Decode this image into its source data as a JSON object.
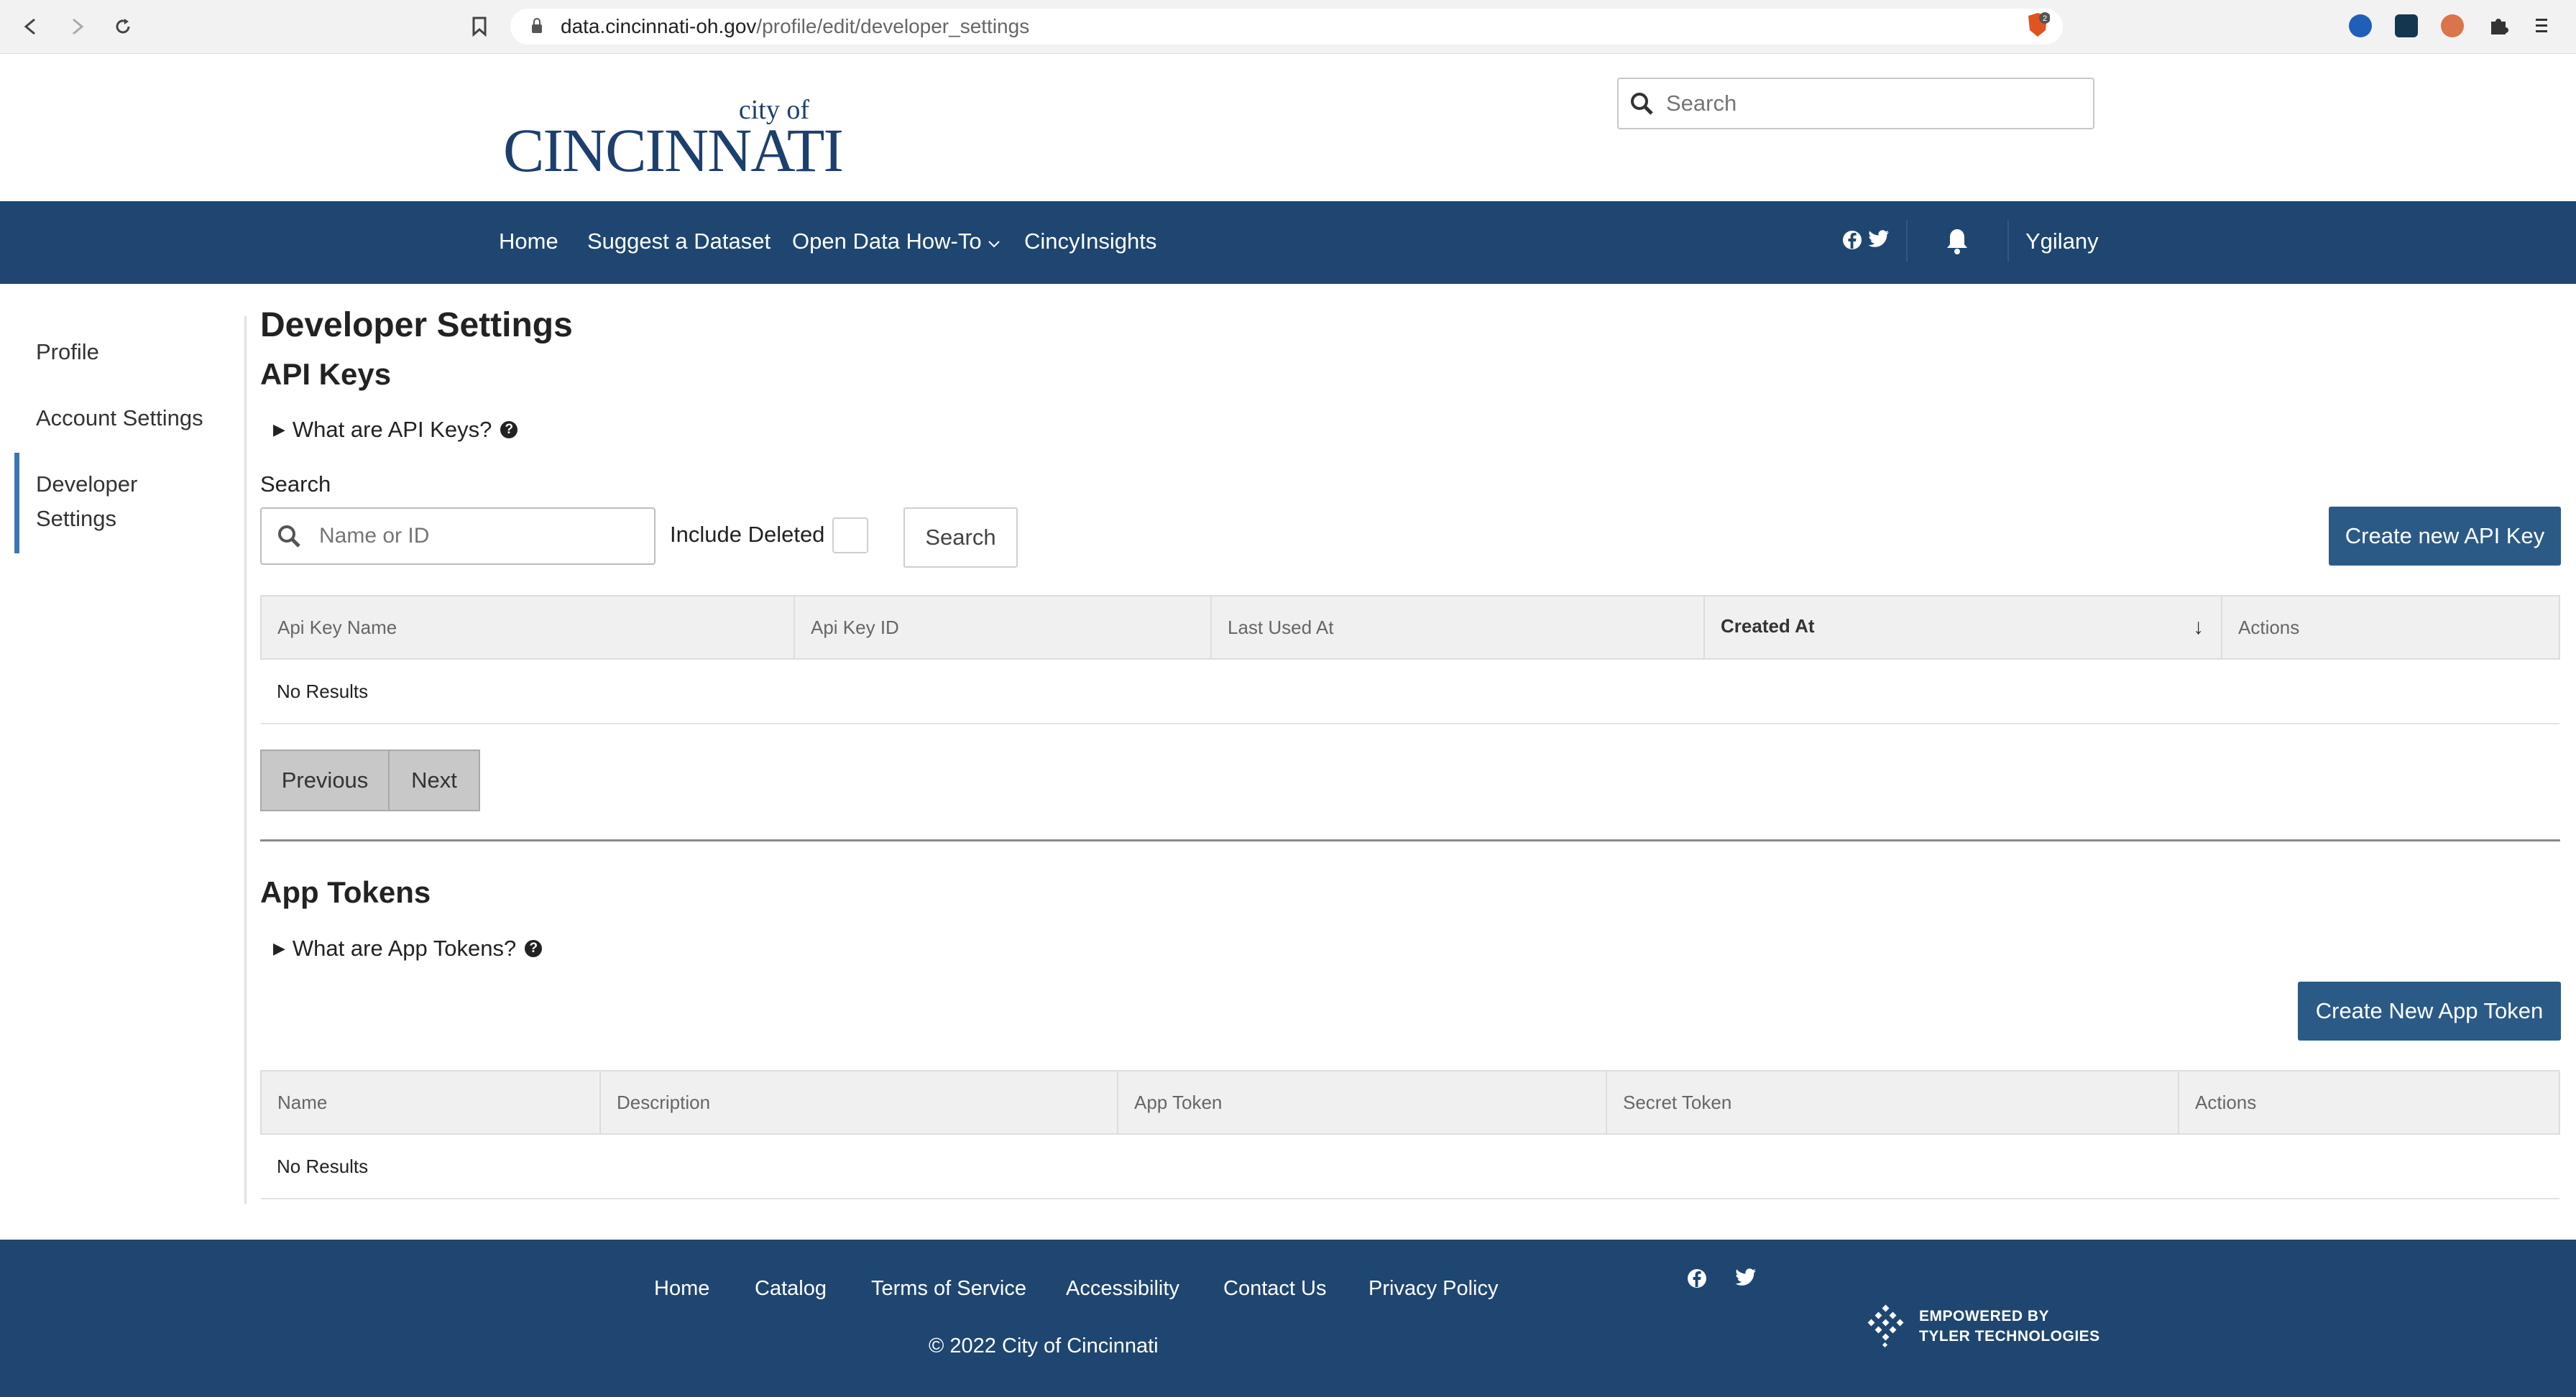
{
  "browser": {
    "url_domain": "data.cincinnati-oh.gov",
    "url_path": "/profile/edit/developer_settings",
    "brave_badge": "2",
    "back_icon": "back-icon",
    "forward_icon": "forward-icon",
    "reload_icon": "reload-icon",
    "bookmark_icon": "bookmark-icon",
    "menu_icon": "menu-icon"
  },
  "header": {
    "logo_city_of": "city of",
    "logo_name": "CINCINNATI",
    "search_placeholder": "Search"
  },
  "nav": {
    "items": [
      "Home",
      "Suggest a Dataset",
      "Open Data How-To",
      "CincyInsights"
    ],
    "user": "Ygilany"
  },
  "sidebar": {
    "items": [
      "Profile",
      "Account Settings",
      "Developer",
      "Settings"
    ]
  },
  "main": {
    "title": "Developer Settings",
    "api_keys": {
      "heading": "API Keys",
      "help_toggle": "What are API Keys?",
      "search_label": "Search",
      "search_placeholder": "Name or ID",
      "include_deleted": "Include Deleted",
      "search_button": "Search",
      "create_button": "Create new API Key",
      "columns": [
        "Api Key Name",
        "Api Key ID",
        "Last Used At",
        "Created At",
        "Actions"
      ],
      "empty_text": "No Results",
      "prev": "Previous",
      "next": "Next"
    },
    "app_tokens": {
      "heading": "App Tokens",
      "help_toggle": "What are App Tokens?",
      "create_button": "Create New App Token",
      "columns": [
        "Name",
        "Description",
        "App Token",
        "Secret Token",
        "Actions"
      ],
      "empty_text": "No Results"
    }
  },
  "footer": {
    "links": [
      "Home",
      "Catalog",
      "Terms of Service",
      "Accessibility",
      "Contact Us",
      "Privacy Policy"
    ],
    "copyright": "© 2022 City of Cincinnati",
    "tyler_line1": "EMPOWERED BY",
    "tyler_line2": "TYLER TECHNOLOGIES"
  },
  "colors": {
    "nav_bg": "#1e4670",
    "primary_button": "#2b5a86",
    "active_sidebar": "#3c76b4"
  }
}
